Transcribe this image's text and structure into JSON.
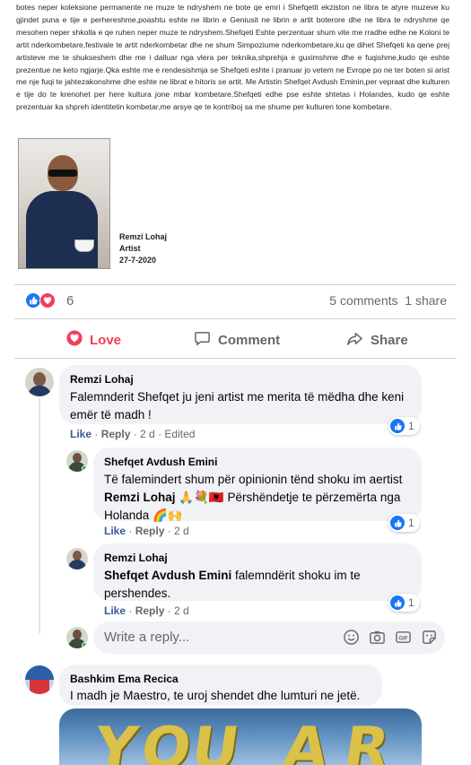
{
  "post": {
    "letter_text": "botes neper koleksione permanente ne muze te ndryshem ne bote qe emri i Shefqetit ekziston ne libra te atyre muzeve ku gjindet puna e tije e perhereshme,poashtu eshte ne librin e Geniusit ne librin e artit boterore dhe ne libra te ndryshme qe mesohen neper shkolla e qe ruhen neper muze te ndryshem.Shefqeti Eshte perzentuar shum vite me rradhe edhe ne Koloni te artit nderkombetare,festivale te artit nderkombetar dhe ne shum Simpoziume nderkombetare,ku qe dihet Shefqeti ka qene prej artisteve me te shukseshem dhe me i dalluar nga vlera per teknika,shprehja e guximshme dhe e fuqishme,kudo qe eshte prezentue ne keto ngjarje.Qka eshte me e rendesishmja se Shefqeti eshte i pranuar jo vetem ne Evrope po ne ter boten si arist me nje fuqi te jahtezakonshme dhe eshte ne librat e hitoris se artit. Me Artistin Shefqet Avdush Eminin,per vepraat dhe kulturen e tije do te krenohet per here kultura jone mbar kombetare,Shefqeti edhe pse eshte shtetas i Holandes, kudo qe eshte prezentuar ka shpreh identitetin kombetar,me arsye qe te kontriboj sa me shume per kulturen tone kombetare.",
    "signature_name": "Remzi Lohaj",
    "signature_role": "Artist",
    "signature_date": "27-7-2020",
    "reaction_count": "6",
    "comments_count": "5 comments",
    "shares_count": "1 share"
  },
  "actions": {
    "love": "Love",
    "comment": "Comment",
    "share": "Share"
  },
  "comments": [
    {
      "author": "Remzi Lohaj",
      "text": "Falemnderit Shefqet ju jeni artist me merita të mëdha dhe keni emër të madh !",
      "like": "Like",
      "reply": "Reply",
      "time": "2 d",
      "edited": "Edited",
      "reactions": "1"
    },
    {
      "author": "Shefqet Avdush Emini",
      "text_pre": "Të falemindert shum për opinionin tënd shoku im aertist ",
      "mention": "Remzi Lohaj",
      "text_post": " Përshëndetje te përzemërta nga Holanda",
      "like": "Like",
      "reply": "Reply",
      "time": "2 d",
      "reactions": "1"
    },
    {
      "author": "Remzi Lohaj",
      "mention": "Shefqet Avdush Emini",
      "text_post": " falemndërit shoku im te pershendes.",
      "like": "Like",
      "reply": "Reply",
      "time": "2 d",
      "reactions": "1"
    },
    {
      "author": "Bashkim Ema Recica",
      "text": "I madh je Maestro, te uroj shendet dhe lumturi ne jetë."
    }
  ],
  "reply_box": {
    "placeholder": "Write a reply..."
  },
  "gif": {
    "letters": [
      "Y",
      "O",
      "U",
      "A",
      "R"
    ]
  },
  "colors": {
    "like_blue": "#1877f2",
    "love_red": "#f33e58",
    "link_blue": "#385898",
    "bubble_gray": "#f0f2f5",
    "muted": "#65676b"
  },
  "icons": {
    "like": "thumbs-up-icon",
    "love": "heart-icon",
    "comment": "speech-bubble-icon",
    "share": "share-arrow-icon",
    "emoji": "smiley-icon",
    "camera": "camera-icon",
    "gif": "gif-icon",
    "sticker": "sticker-icon"
  }
}
